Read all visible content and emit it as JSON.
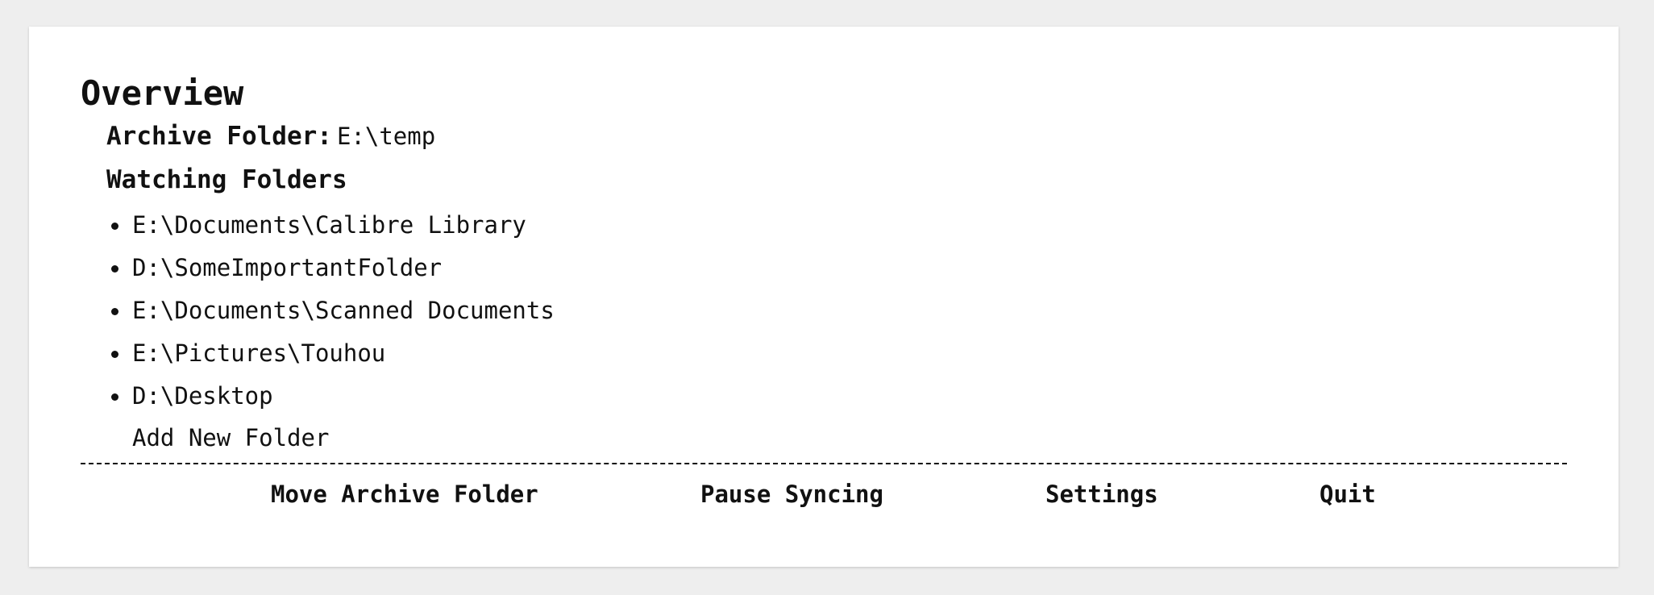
{
  "overview": {
    "title": "Overview",
    "archive_label": "Archive Folder:",
    "archive_value": "E:\\temp",
    "watching_title": "Watching Folders",
    "folders": [
      "E:\\Documents\\Calibre Library",
      "D:\\SomeImportantFolder",
      "E:\\Documents\\Scanned Documents",
      "E:\\Pictures\\Touhou",
      "D:\\Desktop"
    ],
    "add_folder_label": "Add New Folder"
  },
  "actions": {
    "move_archive": "Move Archive Folder",
    "pause_syncing": "Pause Syncing",
    "settings": "Settings",
    "quit": "Quit"
  }
}
